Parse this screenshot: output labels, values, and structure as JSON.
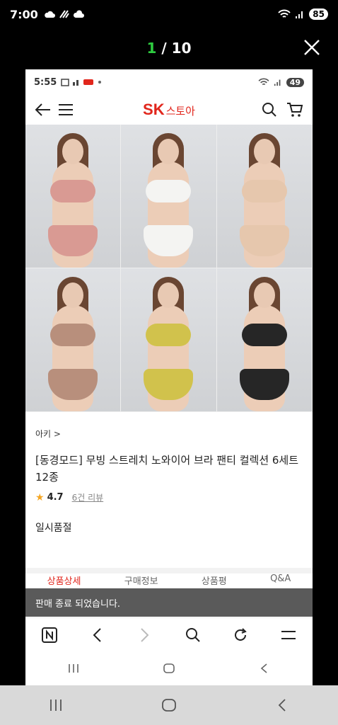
{
  "os_status": {
    "time": "7:00",
    "battery": "85"
  },
  "viewer": {
    "current": "1",
    "separator": " / ",
    "total": "10"
  },
  "inner_status": {
    "time": "5:55",
    "battery": "49"
  },
  "app": {
    "logo_brand": "SK",
    "logo_store": "스토아"
  },
  "product": {
    "brand_link": "아키 >",
    "title": "[동경모드] 무빙 스트레치 노와이어 브라 팬티 컬렉션 6세트 12종",
    "rating": "4.7",
    "reviews": "6건 리뷰",
    "status": "일시품절",
    "swatches": [
      "#d99a93",
      "#f4f4f2",
      "#e6c7ad",
      "#b88f7c",
      "#d1c24c",
      "#262626"
    ]
  },
  "tabs_peek": [
    "상품상세",
    "구매정보",
    "상품평",
    "Q&A"
  ],
  "toast": "판매 종료 되었습니다.",
  "colors": {
    "accent": "#e1261c",
    "toast_bg": "#5a5a5a"
  },
  "icons": [
    "back-arrow-icon",
    "menu-icon",
    "search-icon",
    "cart-icon",
    "close-icon",
    "naver-icon",
    "chevron-left-icon",
    "chevron-right-icon",
    "refresh-icon",
    "hamburger-icon",
    "recents-icon",
    "home-icon",
    "back-icon"
  ]
}
